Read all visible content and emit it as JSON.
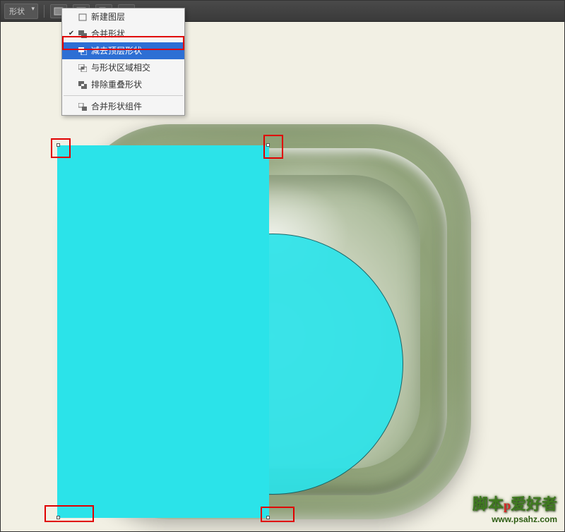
{
  "toolbar": {
    "shape_label": "形状"
  },
  "menu": {
    "new_layer": "新建图层",
    "combine": "合并形状",
    "subtract": "减去顶层形状",
    "intersect": "与形状区域相交",
    "exclude": "排除重叠形状",
    "merge_components": "合并形状组件"
  },
  "watermark": {
    "brand_left": "脚本",
    "brand_right": "爱好者",
    "logo_letter": "p",
    "url": "www.psahz.com"
  },
  "colors": {
    "highlight": "#2d6fd4",
    "red_box": "#e00000",
    "cyan": "#2be3e9"
  }
}
